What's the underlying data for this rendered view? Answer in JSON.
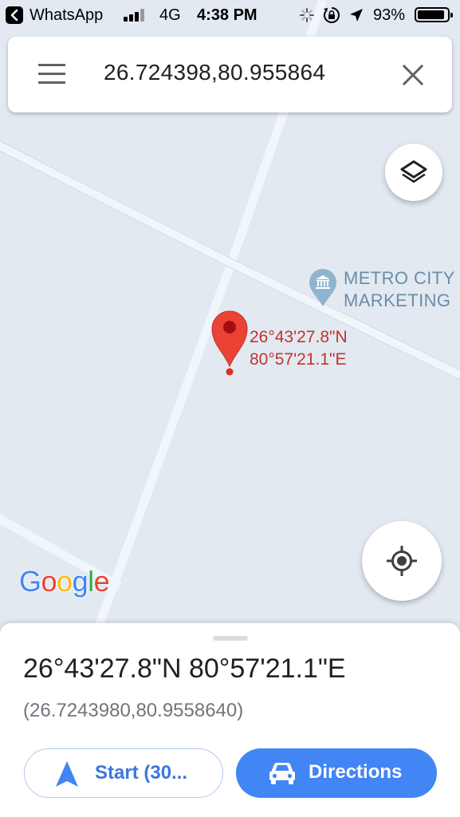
{
  "status_bar": {
    "back_app": "WhatsApp",
    "network": "4G",
    "time": "4:38 PM",
    "battery": "93%",
    "battery_level": 0.93,
    "icons": [
      "back-arrow-icon",
      "signal-bars-icon",
      "activity-spinner-icon",
      "rotation-lock-icon",
      "location-arrow-icon",
      "battery-icon"
    ]
  },
  "search": {
    "query": "26.724398,80.955864",
    "menu_icon": "hamburger-menu-icon",
    "clear_icon": "close-icon"
  },
  "map": {
    "layers_icon": "layers-icon",
    "locate_icon": "my-location-icon",
    "poi": {
      "icon": "museum-pin-icon",
      "name_line1": "METRO CITY",
      "name_line2": "MARKETING"
    },
    "dropped_pin": {
      "icon": "red-pin-icon",
      "lat_label": "26°43'27.8\"N",
      "lng_label": "80°57'21.1\"E"
    },
    "logo": "Google",
    "colors": {
      "background": "#e2e9f1",
      "road": "#f1f6fb",
      "pin": "#ea4335",
      "pin_label": "#c5322b",
      "poi_text": "#6b8da7"
    }
  },
  "sheet": {
    "title": "26°43'27.8\"N 80°57'21.1\"E",
    "subtitle": "(26.7243980,80.9558640)",
    "start_label": "Start (30...",
    "directions_label": "Directions",
    "colors": {
      "accent": "#4285f4"
    }
  }
}
